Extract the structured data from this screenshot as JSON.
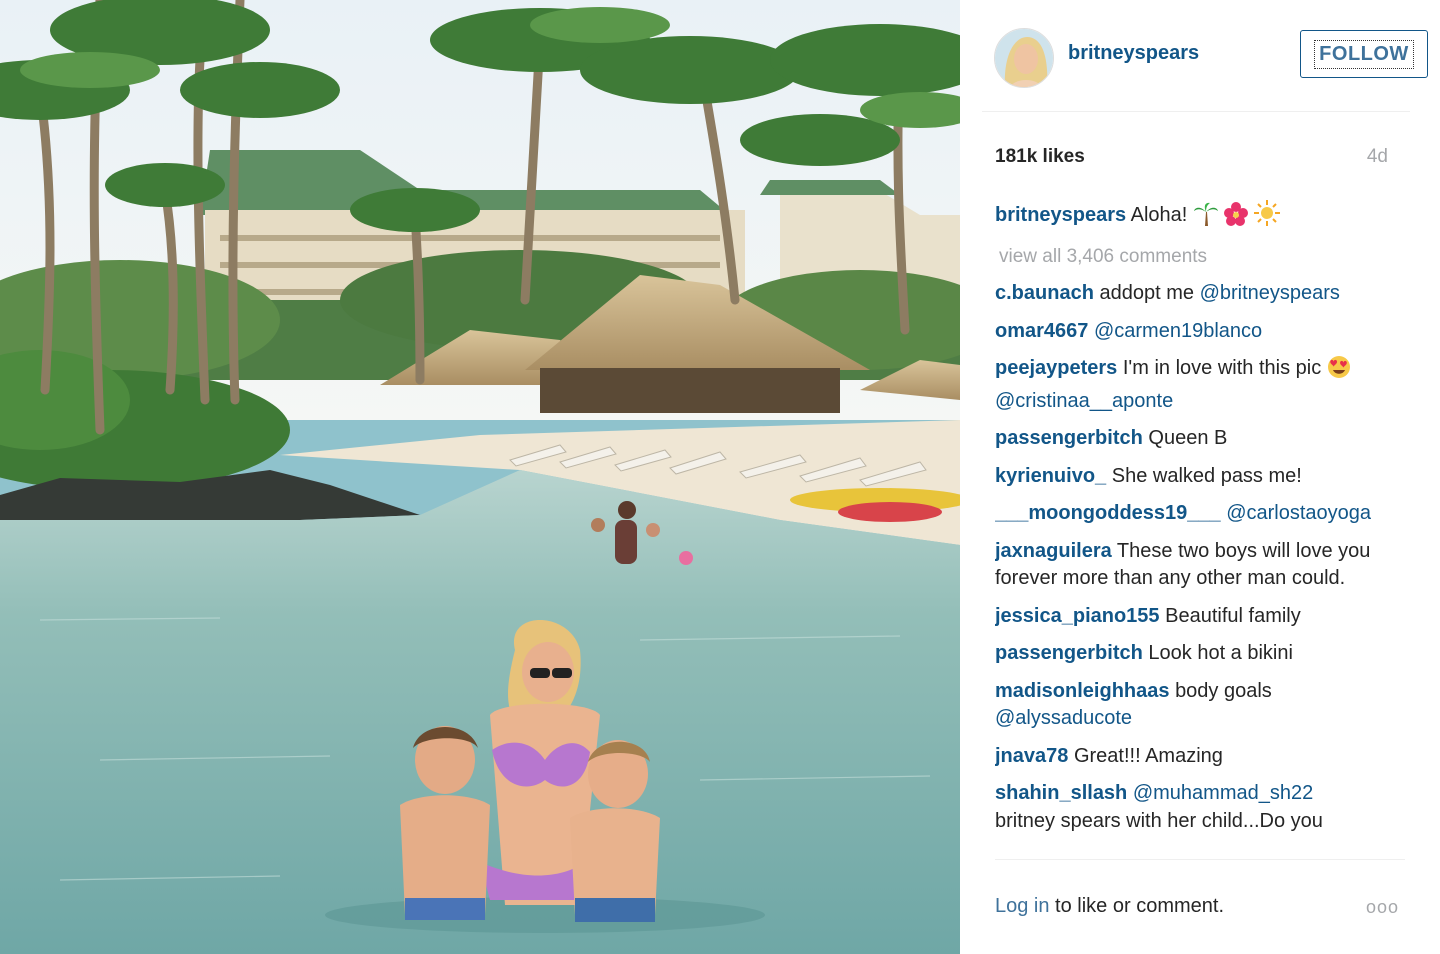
{
  "header": {
    "username": "britneyspears",
    "follow_label": "FOLLOW"
  },
  "stats": {
    "likes": "181k likes",
    "time": "4d"
  },
  "caption": {
    "user": "britneyspears",
    "text": "Aloha!"
  },
  "view_all": "view all 3,406 comments",
  "comments": [
    {
      "user": "c.baunach",
      "text": "addopt me ",
      "mention": "@britneyspears"
    },
    {
      "user": "omar4667",
      "text": "",
      "mention": "@carmen19blanco"
    },
    {
      "user": "peejaypeters",
      "text": "I'm in love with this pic",
      "mention": "@cristinaa__aponte"
    },
    {
      "user": "passengerbitch",
      "text": "Queen B",
      "mention": ""
    },
    {
      "user": "kyrienuivo_",
      "text": "She walked pass me!",
      "mention": ""
    },
    {
      "user": "___moongoddess19___",
      "text": "",
      "mention": "@carlostaoyoga"
    },
    {
      "user": "jaxnaguilera",
      "text": "These two boys will love you forever more than any other man could.",
      "mention": ""
    },
    {
      "user": "jessica_piano155",
      "text": "Beautiful family",
      "mention": ""
    },
    {
      "user": "passengerbitch",
      "text": "Look hot a bikini",
      "mention": ""
    },
    {
      "user": "madisonleighhaas",
      "text": "body goals",
      "mention": "@alyssaducote"
    },
    {
      "user": "jnava78",
      "text": "Great!!! Amazing",
      "mention": ""
    },
    {
      "user": "shahin_sllash",
      "text": "britney spears with her child...Do you",
      "mention": "@muhammad_sh22"
    }
  ],
  "footer": {
    "login_link": "Log in",
    "login_text": " to like or comment.",
    "more": "ooo"
  },
  "colors": {
    "username_blue": "#125688",
    "link_blue": "#3f729b",
    "muted_gray": "#a5a7aa"
  },
  "icons": {
    "caption_emoji": [
      "palm-tree-icon",
      "hibiscus-icon",
      "sun-icon"
    ],
    "comment_emoji": "heart-eyes-icon"
  }
}
